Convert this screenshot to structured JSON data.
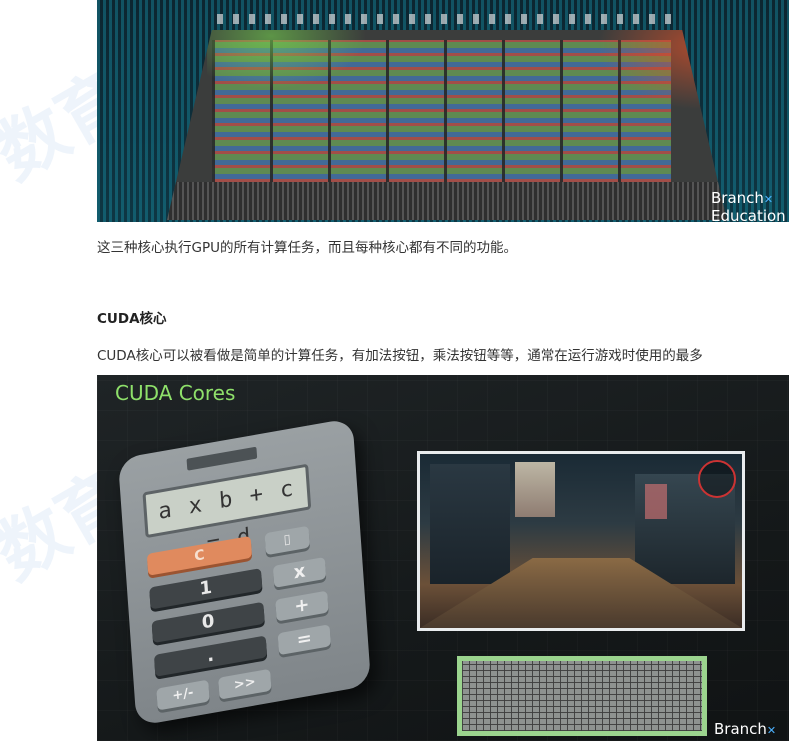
{
  "figure1": {
    "branding": [
      "Branch",
      "Education"
    ]
  },
  "paragraph1": "这三种核心执行GPU的所有计算任务，而且每种核心都有不同的功能。",
  "section_heading": "CUDA核心",
  "paragraph2": "CUDA核心可以被看做是简单的计算任务，有加法按钮，乘法按钮等等，通常在运行游戏时使用的最多",
  "figure2": {
    "title": "CUDA Cores",
    "calculator": {
      "display": "a x b + c = d",
      "keys": [
        "C",
        "1",
        "x",
        "0",
        "+",
        ".",
        "=",
        "+/-",
        ">>"
      ]
    },
    "branding": "Branch"
  }
}
